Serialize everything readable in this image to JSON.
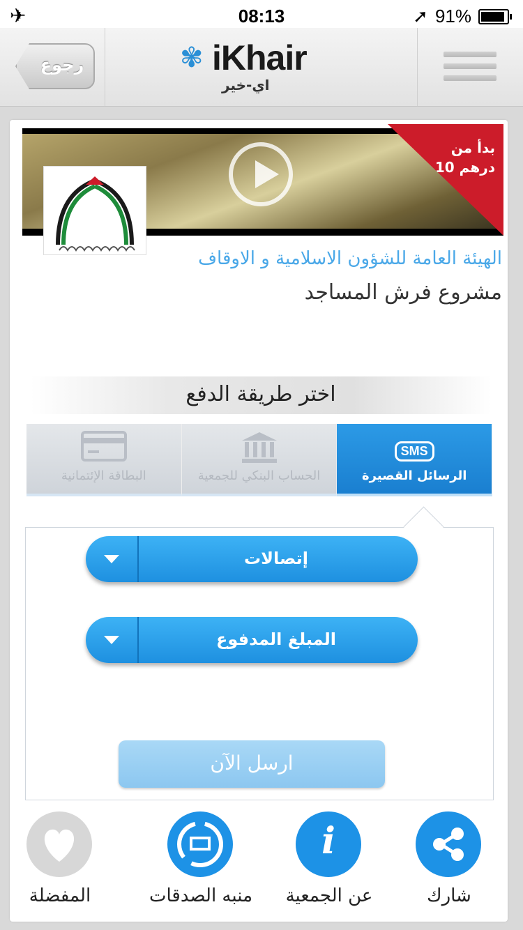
{
  "status_bar": {
    "time": "08:13",
    "battery": "91%"
  },
  "nav": {
    "back_label": "رجوع",
    "logo_text": "iKhair",
    "logo_arabic": "اي-خير"
  },
  "project": {
    "ribbon_line1": "بدأ من",
    "ribbon_line2": "10 درهم",
    "org_name": "الهيئة العامة للشؤون الاسلامية و الاوقاف",
    "title": "مشروع فرش المساجد"
  },
  "payment": {
    "header": "اختر طريقة الدفع",
    "tabs": [
      {
        "label": "البطاقة الإئتمانية",
        "icon": "credit-card-icon",
        "active": false
      },
      {
        "label": "الحساب البنكي للجمعية",
        "icon": "bank-icon",
        "active": false
      },
      {
        "label": "الرسائل القصيرة",
        "icon": "sms-icon",
        "badge": "SMS",
        "active": true
      }
    ],
    "operator_select": "إتصالات",
    "amount_select": "المبلغ المدفوع",
    "send_label": "ارسل الآن"
  },
  "bottom": {
    "favorite": "المفضلة",
    "charity_platform": "منبه الصدقات",
    "about": "عن الجمعية",
    "share": "شارك"
  },
  "colors": {
    "accent": "#1d92e6",
    "link": "#4aa8e8",
    "ribbon": "#cc1c2a"
  }
}
